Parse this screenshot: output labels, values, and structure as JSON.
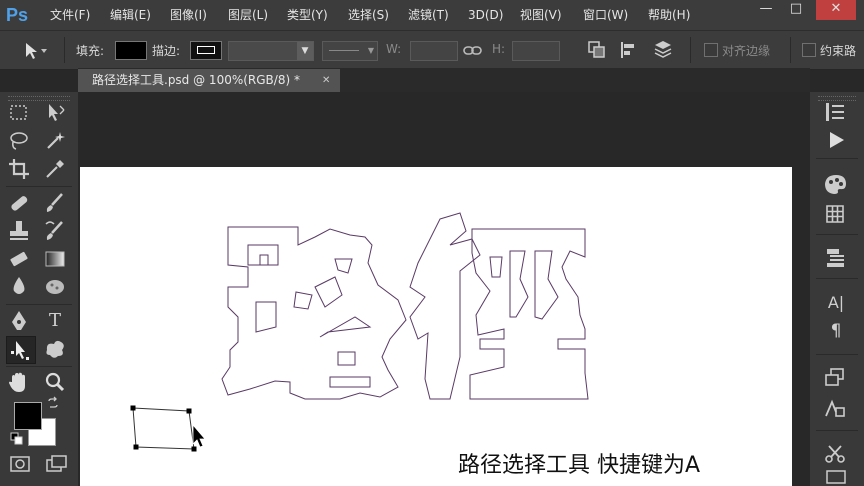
{
  "app": {
    "logo": "Ps"
  },
  "menu": [
    "文件(F)",
    "编辑(E)",
    "图像(I)",
    "图层(L)",
    "类型(Y)",
    "选择(S)",
    "滤镜(T)",
    "3D(D)",
    "视图(V)",
    "窗口(W)",
    "帮助(H)"
  ],
  "window_controls": {
    "minimize": "—",
    "maximize": "□",
    "close": "✕"
  },
  "options": {
    "fill_label": "填充:",
    "stroke_label": "描边:",
    "w_label": "W:",
    "h_label": "H:",
    "align_edges_label": "对齐边缘",
    "constrain_label": "约束路",
    "fill_color": "#000000",
    "stroke_color": "#ffffff"
  },
  "document": {
    "tab_title": "路径选择工具.psd @ 100%(RGB/8) *",
    "close_label": "✕"
  },
  "canvas": {
    "characters": [
      "路",
      "徑"
    ],
    "caption": "路径选择工具 快捷键为A"
  },
  "colors": {
    "foreground": "#000000",
    "background": "#ffffff",
    "accent": "#4fa2ea"
  },
  "left_tools": [
    "move-tool",
    "rect-marquee-tool",
    "lasso-tool",
    "magic-wand-tool",
    "crop-tool",
    "eyedropper-tool",
    "healing-brush-tool",
    "brush-tool",
    "clone-stamp-tool",
    "history-brush-tool",
    "eraser-tool",
    "gradient-tool",
    "blur-tool",
    "dodge-tool",
    "pen-tool",
    "type-tool",
    "path-selection-tool",
    "shape-tool",
    "hand-tool",
    "zoom-tool"
  ],
  "right_tools": [
    "history-panel",
    "actions-panel",
    "color-panel",
    "swatches-panel",
    "layers-panel",
    "character-panel",
    "paragraph-panel",
    "layer-comps-panel",
    "styles-panel",
    "tool-presets-panel"
  ],
  "type_tool_glyph": "T",
  "paragraph_glyph": "¶",
  "character_glyph": "A|"
}
